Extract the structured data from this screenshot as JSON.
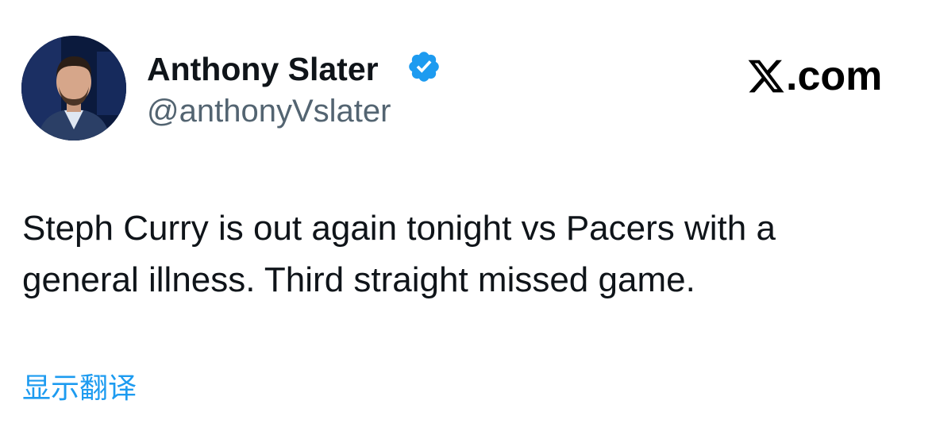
{
  "author": {
    "display_name": "Anthony Slater",
    "handle": "@anthonyVslater",
    "verified": true,
    "avatar_icon": "person-avatar-photo"
  },
  "platform": {
    "logo_icon": "x-logo-icon",
    "domain": ".com"
  },
  "tweet": {
    "text_lines": [
      "Steph Curry is out again tonight vs Pacers with a",
      "general illness. Third straight missed game."
    ]
  },
  "translate": {
    "label": "显示翻译"
  },
  "colors": {
    "name_text": "#0f1419",
    "handle_text": "#536471",
    "verified_badge": "#1d9bf0",
    "link_blue": "#1d9bf0",
    "background": "#ffffff"
  }
}
